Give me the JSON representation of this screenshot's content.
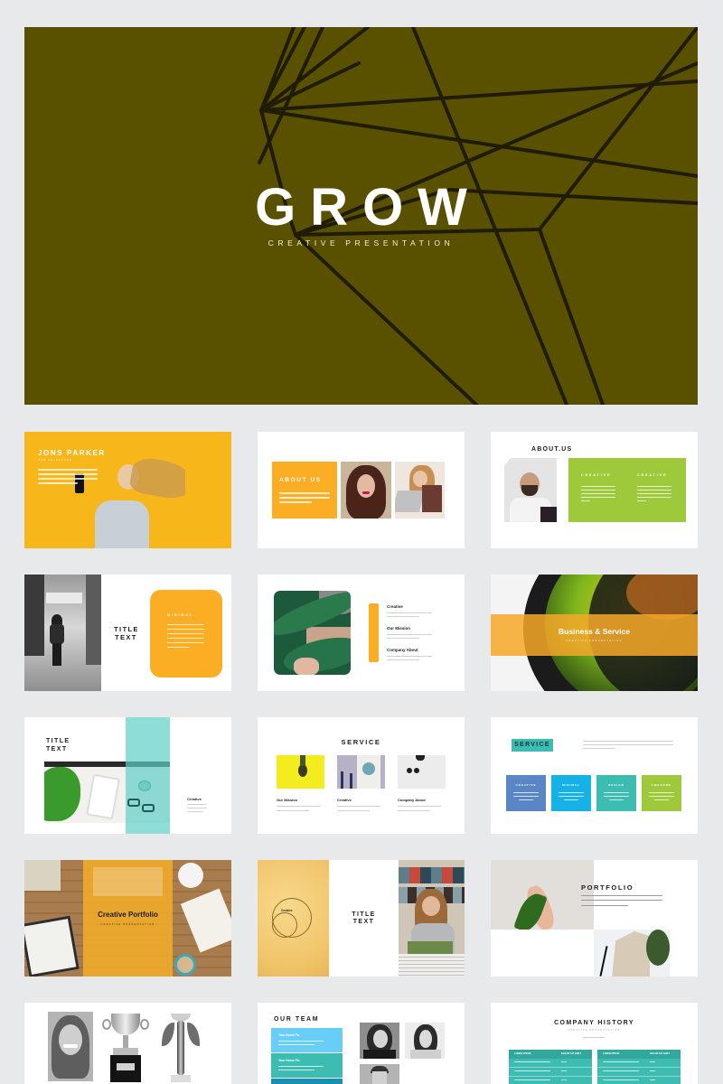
{
  "colors": {
    "page_bg": "#e8e9eb",
    "hero_bg": "#5a5100",
    "orange": "#fbae24",
    "green": "#9dc93b",
    "teal": "#3dbdb1",
    "blue": "#5b86c5",
    "sky": "#16b2e6"
  },
  "hero": {
    "title": "GROW",
    "subtitle": "CREATIVE PRESENTATION"
  },
  "slides": [
    {
      "id": "jons-parker",
      "title": "JONS PARKER",
      "subtitle": "WEB DEVELOPER",
      "photo": "woman-with-headphones-selfie"
    },
    {
      "id": "about-us-1",
      "title": "ABOUT US",
      "photos": [
        "woman-portrait",
        "woman-with-laptop"
      ]
    },
    {
      "id": "about-us-2",
      "title": "ABOUT.US",
      "columns": [
        "CREATIVE",
        "CREATIVE"
      ],
      "photo": "man-with-glasses"
    },
    {
      "id": "title-minimal",
      "title_line1": "TITLE",
      "title_line2": "TEXT",
      "box_label": "MINIMAL",
      "photo": "street-walker-bw"
    },
    {
      "id": "leaf-list",
      "items": [
        "Creative",
        "Our Mission",
        "Company About"
      ],
      "photo": "woman-behind-leaf"
    },
    {
      "id": "business-service",
      "title": "Business & Service",
      "subtitle": "CREATIVE PRESENTATION",
      "photo": "camera-lens"
    },
    {
      "id": "title-teal",
      "title_line1": "TITLE",
      "title_line2": "TEXT",
      "item": "Creative",
      "photo": "desk-with-tablet"
    },
    {
      "id": "service-1",
      "title": "SERVICE",
      "items": [
        "Our Mission",
        "Creative",
        "Company About"
      ],
      "photos": [
        "pineapple",
        "frame-art",
        "sunglasses"
      ]
    },
    {
      "id": "service-2",
      "title": "SERVICE",
      "boxes": [
        "CREATIVE",
        "MINIMAL",
        "DESIGN",
        "AWESOME"
      ]
    },
    {
      "id": "creative-portfolio",
      "title": "Creative Portfolio",
      "subtitle": "CREATIVE PRESENTATION",
      "photo": "wooden-desk"
    },
    {
      "id": "title-yellow",
      "title_line1": "TITLE",
      "title_line2": "TEXT",
      "circle_label": "Creative",
      "photo": "woman-record-store"
    },
    {
      "id": "portfolio",
      "title": "PORTFOLIO",
      "photos": [
        "hand-with-leaf",
        "building"
      ]
    },
    {
      "id": "awards",
      "photos": [
        "smiling-man-bw",
        "trophy-cup",
        "trophy-statue"
      ]
    },
    {
      "id": "our-team",
      "title": "OUR TEAM",
      "members": [
        "Your Name Pic",
        "Your Name Pic"
      ]
    },
    {
      "id": "company-history",
      "title": "COMPANY HISTORY",
      "subtitle": "CREATIVE PRESENTATION",
      "table_headers": [
        "LOREM IPSUM",
        "DOLOR SIT AMET"
      ]
    }
  ]
}
